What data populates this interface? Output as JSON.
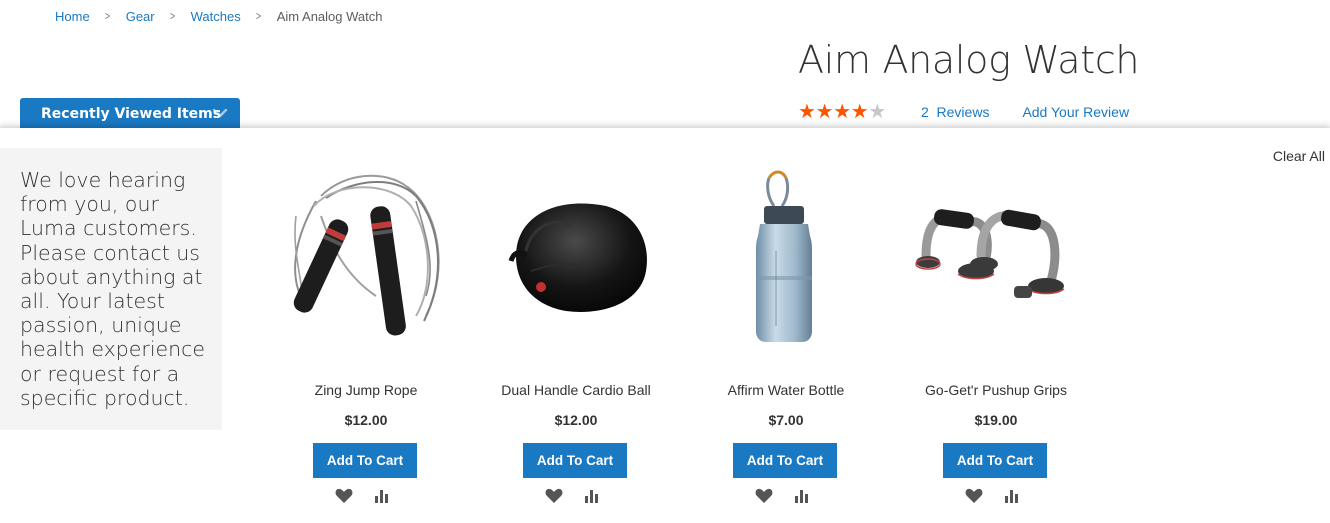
{
  "breadcrumb": {
    "items": [
      {
        "label": "Home"
      },
      {
        "label": "Gear"
      },
      {
        "label": "Watches"
      }
    ],
    "separator": ">",
    "current": "Aim Analog Watch"
  },
  "product": {
    "title": "Aim Analog Watch",
    "rating_stars": 4,
    "rating_max": 5,
    "reviews_label": "2  Reviews",
    "add_review_label": "Add Your Review"
  },
  "recently_viewed": {
    "toggle_label": "Recently Viewed Items",
    "clear_all_label": "Clear All",
    "promo_text": "We love hearing from you, our Luma customers. Please contact us about anything at all. Your latest passion, unique health experience or request for a specific product.",
    "items": [
      {
        "name": "Zing Jump Rope",
        "price": "$12.00",
        "cart_label": "Add To Cart",
        "image": "jump-rope-image"
      },
      {
        "name": "Dual Handle Cardio Ball",
        "price": "$12.00",
        "cart_label": "Add To Cart",
        "image": "cardio-ball-image"
      },
      {
        "name": "Affirm Water Bottle",
        "price": "$7.00",
        "cart_label": "Add To Cart",
        "image": "water-bottle-image"
      },
      {
        "name": "Go-Get'r Pushup Grips",
        "price": "$19.00",
        "cart_label": "Add To Cart",
        "image": "pushup-grips-image"
      }
    ]
  },
  "colors": {
    "accent": "#1979c3",
    "star": "#ff5501",
    "star_empty": "#c7c7c7",
    "promo_bg": "#f4f4f4"
  },
  "icons": [
    "chevron-right-icon",
    "chevron-down-icon",
    "star-icon",
    "heart-icon",
    "compare-icon"
  ]
}
